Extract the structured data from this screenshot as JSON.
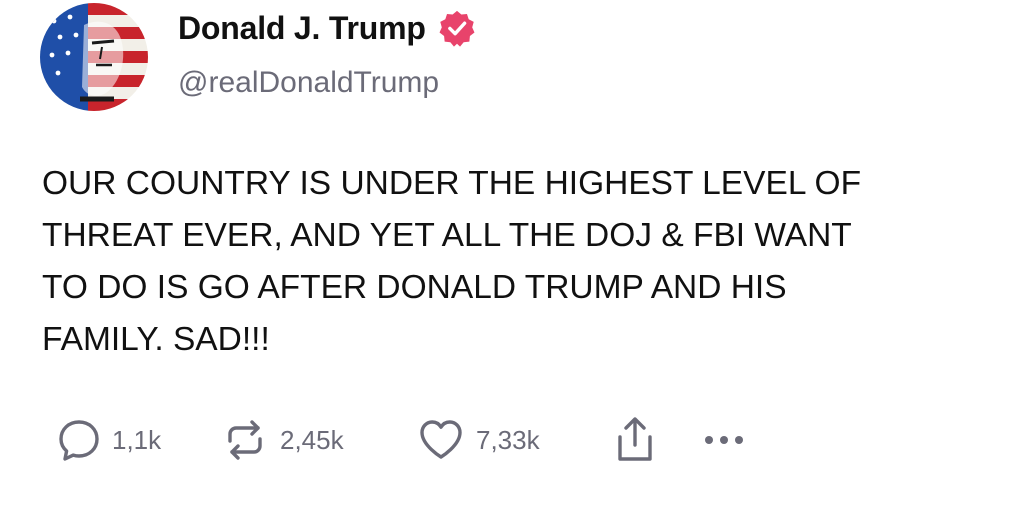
{
  "post": {
    "author": {
      "display_name": "Donald J. Trump",
      "handle": "@realDonaldTrump",
      "avatar_icon": "avatar-flag-portrait",
      "verified_icon": "verified-badge-icon",
      "verified_color": "#e8436b"
    },
    "text": "OUR COUNTRY IS UNDER THE HIGHEST LEVEL OF\nTHREAT EVER, AND YET ALL THE DOJ & FBI WANT\nTO DO IS GO AFTER DONALD TRUMP AND HIS\nFAMILY. SAD!!!",
    "actions": {
      "reply": {
        "icon": "reply-icon",
        "count": "1,1k"
      },
      "repost": {
        "icon": "repost-icon",
        "count": "2,45k"
      },
      "like": {
        "icon": "heart-icon",
        "count": "7,33k"
      },
      "share": {
        "icon": "share-icon"
      },
      "more": {
        "icon": "more-icon"
      }
    },
    "colors": {
      "text": "#111111",
      "muted": "#6b6b78"
    }
  }
}
